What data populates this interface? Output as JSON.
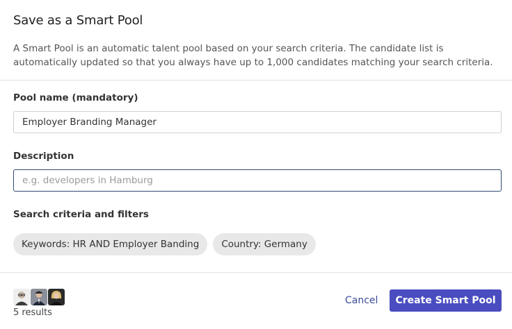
{
  "dialog": {
    "title": "Save as a Smart Pool",
    "intro": "A Smart Pool is an automatic talent pool based on your search criteria. The candidate list is automatically updated so that you always have up to 1,000 candidates matching your search criteria."
  },
  "form": {
    "pool_name_label": "Pool name (mandatory)",
    "pool_name_value": "Employer Branding Manager",
    "description_label": "Description",
    "description_value": "",
    "description_placeholder": "e.g. developers in Hamburg",
    "criteria_label": "Search criteria and filters",
    "criteria": [
      "Keywords: HR AND Employer Banding",
      "Country: Germany"
    ]
  },
  "footer": {
    "results_label": "5 results",
    "cancel_label": "Cancel",
    "create_label": "Create Smart Pool",
    "avatars": [
      "avatar-man-glasses",
      "avatar-man-suit",
      "avatar-woman-blonde"
    ]
  },
  "colors": {
    "primary": "#4a4dbf",
    "link": "#3b4a9b",
    "chip_bg": "#e8e8e8",
    "focus_border": "#2f4a6e"
  }
}
